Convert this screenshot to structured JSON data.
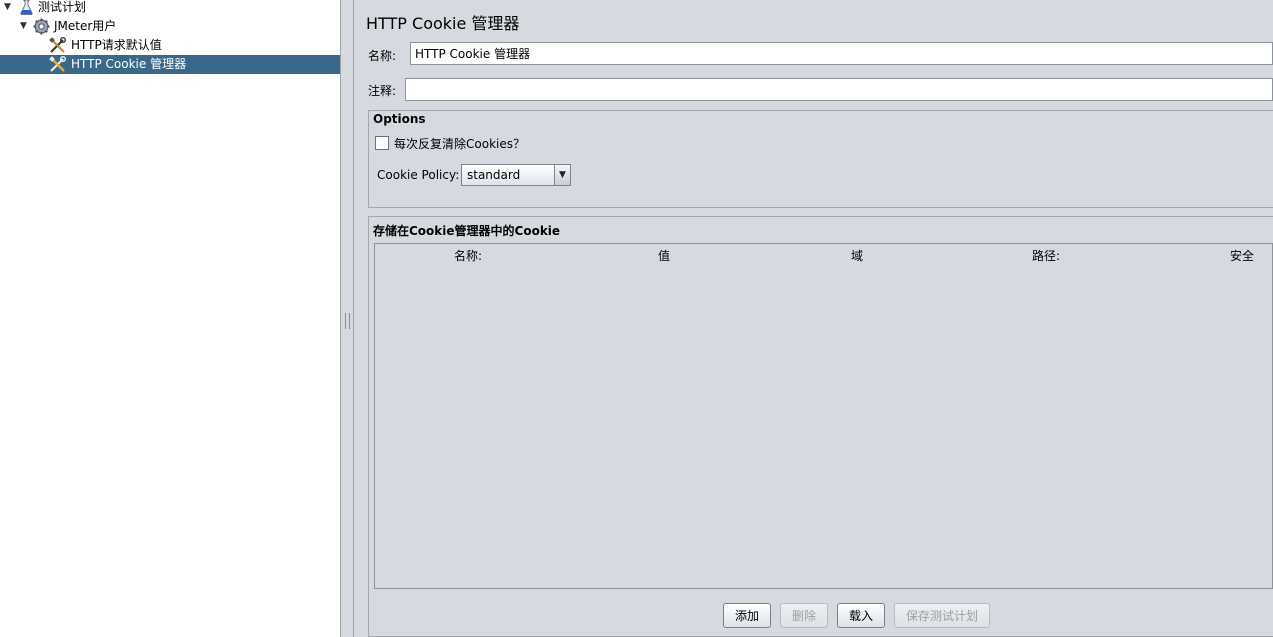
{
  "tree": {
    "items": [
      {
        "label": "测试计划",
        "icon": "test-plan-flask-icon",
        "expanded": true
      },
      {
        "label": "JMeter用户",
        "icon": "thread-group-gear-icon",
        "expanded": true
      },
      {
        "label": "HTTP请求默认值",
        "icon": "config-tools-icon"
      },
      {
        "label": "HTTP Cookie 管理器",
        "icon": "config-tools-icon",
        "selected": true
      }
    ],
    "toggle_glyph": "▼"
  },
  "panel": {
    "title": "HTTP Cookie 管理器",
    "name_label": "名称:",
    "name_value": "HTTP Cookie 管理器",
    "comment_label": "注释:",
    "comment_value": "",
    "options": {
      "title": "Options",
      "clear_each_iteration_label": "每次反复清除Cookies？",
      "clear_each_iteration_checked": false,
      "cookie_policy_label": "Cookie Policy:",
      "cookie_policy_value": "standard",
      "dropdown_glyph": "▼"
    },
    "stored_cookies": {
      "title": "存储在Cookie管理器中的Cookie",
      "columns": [
        "名称:",
        "值",
        "域",
        "路径:",
        "安全"
      ],
      "rows": []
    },
    "buttons": {
      "add": "添加",
      "delete": "删除",
      "load": "载入",
      "save": "保存测试计划"
    }
  },
  "colors": {
    "selection": "#39698a",
    "panel_background": "#d6d9df"
  }
}
